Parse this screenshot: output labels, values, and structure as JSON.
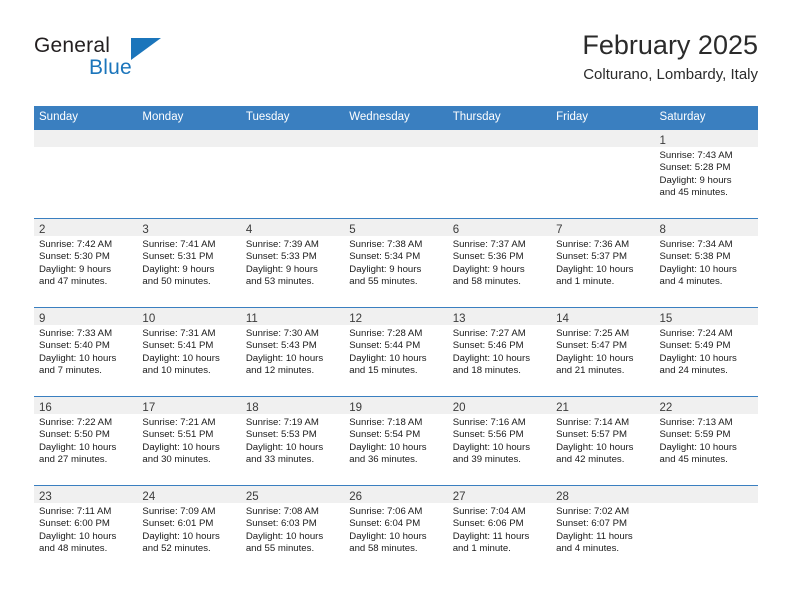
{
  "brand": {
    "name_part1": "General",
    "name_part2": "Blue",
    "triangle_color": "#1b75bb"
  },
  "header": {
    "title": "February 2025",
    "subtitle": "Colturano, Lombardy, Italy"
  },
  "theme": {
    "header_blue": "#3a7fc0",
    "daynum_band": "#f0f0f0",
    "text": "#1a1a1a"
  },
  "weekday_headers": [
    "Sunday",
    "Monday",
    "Tuesday",
    "Wednesday",
    "Thursday",
    "Friday",
    "Saturday"
  ],
  "weeks": [
    [
      {
        "day": "",
        "empty": true,
        "sunrise": "",
        "sunset": "",
        "daylight1": "",
        "daylight2": ""
      },
      {
        "day": "",
        "empty": true,
        "sunrise": "",
        "sunset": "",
        "daylight1": "",
        "daylight2": ""
      },
      {
        "day": "",
        "empty": true,
        "sunrise": "",
        "sunset": "",
        "daylight1": "",
        "daylight2": ""
      },
      {
        "day": "",
        "empty": true,
        "sunrise": "",
        "sunset": "",
        "daylight1": "",
        "daylight2": ""
      },
      {
        "day": "",
        "empty": true,
        "sunrise": "",
        "sunset": "",
        "daylight1": "",
        "daylight2": ""
      },
      {
        "day": "",
        "empty": true,
        "sunrise": "",
        "sunset": "",
        "daylight1": "",
        "daylight2": ""
      },
      {
        "day": "1",
        "empty": false,
        "sunrise": "Sunrise: 7:43 AM",
        "sunset": "Sunset: 5:28 PM",
        "daylight1": "Daylight: 9 hours",
        "daylight2": "and 45 minutes."
      }
    ],
    [
      {
        "day": "2",
        "empty": false,
        "sunrise": "Sunrise: 7:42 AM",
        "sunset": "Sunset: 5:30 PM",
        "daylight1": "Daylight: 9 hours",
        "daylight2": "and 47 minutes."
      },
      {
        "day": "3",
        "empty": false,
        "sunrise": "Sunrise: 7:41 AM",
        "sunset": "Sunset: 5:31 PM",
        "daylight1": "Daylight: 9 hours",
        "daylight2": "and 50 minutes."
      },
      {
        "day": "4",
        "empty": false,
        "sunrise": "Sunrise: 7:39 AM",
        "sunset": "Sunset: 5:33 PM",
        "daylight1": "Daylight: 9 hours",
        "daylight2": "and 53 minutes."
      },
      {
        "day": "5",
        "empty": false,
        "sunrise": "Sunrise: 7:38 AM",
        "sunset": "Sunset: 5:34 PM",
        "daylight1": "Daylight: 9 hours",
        "daylight2": "and 55 minutes."
      },
      {
        "day": "6",
        "empty": false,
        "sunrise": "Sunrise: 7:37 AM",
        "sunset": "Sunset: 5:36 PM",
        "daylight1": "Daylight: 9 hours",
        "daylight2": "and 58 minutes."
      },
      {
        "day": "7",
        "empty": false,
        "sunrise": "Sunrise: 7:36 AM",
        "sunset": "Sunset: 5:37 PM",
        "daylight1": "Daylight: 10 hours",
        "daylight2": "and 1 minute."
      },
      {
        "day": "8",
        "empty": false,
        "sunrise": "Sunrise: 7:34 AM",
        "sunset": "Sunset: 5:38 PM",
        "daylight1": "Daylight: 10 hours",
        "daylight2": "and 4 minutes."
      }
    ],
    [
      {
        "day": "9",
        "empty": false,
        "sunrise": "Sunrise: 7:33 AM",
        "sunset": "Sunset: 5:40 PM",
        "daylight1": "Daylight: 10 hours",
        "daylight2": "and 7 minutes."
      },
      {
        "day": "10",
        "empty": false,
        "sunrise": "Sunrise: 7:31 AM",
        "sunset": "Sunset: 5:41 PM",
        "daylight1": "Daylight: 10 hours",
        "daylight2": "and 10 minutes."
      },
      {
        "day": "11",
        "empty": false,
        "sunrise": "Sunrise: 7:30 AM",
        "sunset": "Sunset: 5:43 PM",
        "daylight1": "Daylight: 10 hours",
        "daylight2": "and 12 minutes."
      },
      {
        "day": "12",
        "empty": false,
        "sunrise": "Sunrise: 7:28 AM",
        "sunset": "Sunset: 5:44 PM",
        "daylight1": "Daylight: 10 hours",
        "daylight2": "and 15 minutes."
      },
      {
        "day": "13",
        "empty": false,
        "sunrise": "Sunrise: 7:27 AM",
        "sunset": "Sunset: 5:46 PM",
        "daylight1": "Daylight: 10 hours",
        "daylight2": "and 18 minutes."
      },
      {
        "day": "14",
        "empty": false,
        "sunrise": "Sunrise: 7:25 AM",
        "sunset": "Sunset: 5:47 PM",
        "daylight1": "Daylight: 10 hours",
        "daylight2": "and 21 minutes."
      },
      {
        "day": "15",
        "empty": false,
        "sunrise": "Sunrise: 7:24 AM",
        "sunset": "Sunset: 5:49 PM",
        "daylight1": "Daylight: 10 hours",
        "daylight2": "and 24 minutes."
      }
    ],
    [
      {
        "day": "16",
        "empty": false,
        "sunrise": "Sunrise: 7:22 AM",
        "sunset": "Sunset: 5:50 PM",
        "daylight1": "Daylight: 10 hours",
        "daylight2": "and 27 minutes."
      },
      {
        "day": "17",
        "empty": false,
        "sunrise": "Sunrise: 7:21 AM",
        "sunset": "Sunset: 5:51 PM",
        "daylight1": "Daylight: 10 hours",
        "daylight2": "and 30 minutes."
      },
      {
        "day": "18",
        "empty": false,
        "sunrise": "Sunrise: 7:19 AM",
        "sunset": "Sunset: 5:53 PM",
        "daylight1": "Daylight: 10 hours",
        "daylight2": "and 33 minutes."
      },
      {
        "day": "19",
        "empty": false,
        "sunrise": "Sunrise: 7:18 AM",
        "sunset": "Sunset: 5:54 PM",
        "daylight1": "Daylight: 10 hours",
        "daylight2": "and 36 minutes."
      },
      {
        "day": "20",
        "empty": false,
        "sunrise": "Sunrise: 7:16 AM",
        "sunset": "Sunset: 5:56 PM",
        "daylight1": "Daylight: 10 hours",
        "daylight2": "and 39 minutes."
      },
      {
        "day": "21",
        "empty": false,
        "sunrise": "Sunrise: 7:14 AM",
        "sunset": "Sunset: 5:57 PM",
        "daylight1": "Daylight: 10 hours",
        "daylight2": "and 42 minutes."
      },
      {
        "day": "22",
        "empty": false,
        "sunrise": "Sunrise: 7:13 AM",
        "sunset": "Sunset: 5:59 PM",
        "daylight1": "Daylight: 10 hours",
        "daylight2": "and 45 minutes."
      }
    ],
    [
      {
        "day": "23",
        "empty": false,
        "sunrise": "Sunrise: 7:11 AM",
        "sunset": "Sunset: 6:00 PM",
        "daylight1": "Daylight: 10 hours",
        "daylight2": "and 48 minutes."
      },
      {
        "day": "24",
        "empty": false,
        "sunrise": "Sunrise: 7:09 AM",
        "sunset": "Sunset: 6:01 PM",
        "daylight1": "Daylight: 10 hours",
        "daylight2": "and 52 minutes."
      },
      {
        "day": "25",
        "empty": false,
        "sunrise": "Sunrise: 7:08 AM",
        "sunset": "Sunset: 6:03 PM",
        "daylight1": "Daylight: 10 hours",
        "daylight2": "and 55 minutes."
      },
      {
        "day": "26",
        "empty": false,
        "sunrise": "Sunrise: 7:06 AM",
        "sunset": "Sunset: 6:04 PM",
        "daylight1": "Daylight: 10 hours",
        "daylight2": "and 58 minutes."
      },
      {
        "day": "27",
        "empty": false,
        "sunrise": "Sunrise: 7:04 AM",
        "sunset": "Sunset: 6:06 PM",
        "daylight1": "Daylight: 11 hours",
        "daylight2": "and 1 minute."
      },
      {
        "day": "28",
        "empty": false,
        "sunrise": "Sunrise: 7:02 AM",
        "sunset": "Sunset: 6:07 PM",
        "daylight1": "Daylight: 11 hours",
        "daylight2": "and 4 minutes."
      },
      {
        "day": "",
        "empty": true,
        "sunrise": "",
        "sunset": "",
        "daylight1": "",
        "daylight2": ""
      }
    ]
  ]
}
